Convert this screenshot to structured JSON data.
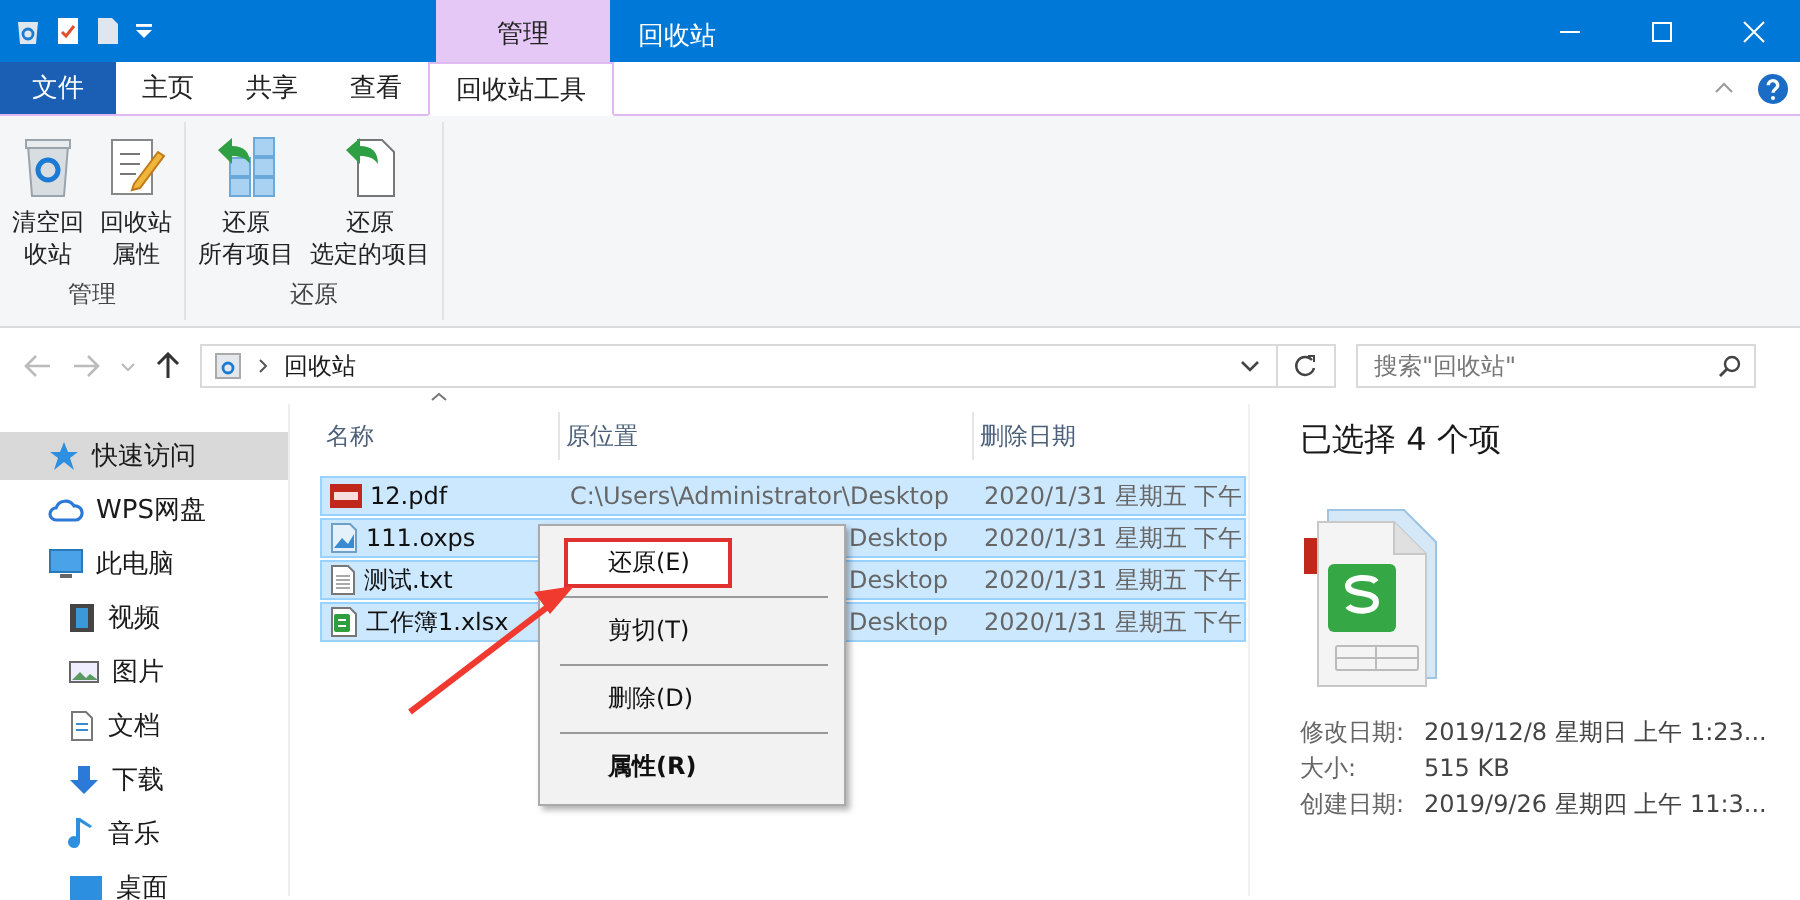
{
  "title_bar": {
    "context_tab": "管理",
    "title": "回收站"
  },
  "ribbon": {
    "tabs": [
      {
        "label": "文件",
        "kind": "file",
        "selected": false
      },
      {
        "label": "主页",
        "kind": "tab",
        "selected": false
      },
      {
        "label": "共享",
        "kind": "tab",
        "selected": false
      },
      {
        "label": "查看",
        "kind": "tab",
        "selected": false
      },
      {
        "label": "回收站工具",
        "kind": "context",
        "selected": true
      }
    ],
    "groups": [
      {
        "label": "管理",
        "buttons": [
          {
            "kind": "empty-bin",
            "lines": [
              "清空回",
              "收站"
            ]
          },
          {
            "kind": "properties",
            "lines": [
              "回收站",
              "属性"
            ]
          }
        ]
      },
      {
        "label": "还原",
        "buttons": [
          {
            "kind": "restore-all",
            "lines": [
              "还原",
              "所有项目"
            ]
          },
          {
            "kind": "restore-selected",
            "lines": [
              "还原",
              "选定的项目"
            ]
          }
        ]
      }
    ]
  },
  "address": {
    "path": "回收站"
  },
  "search": {
    "placeholder": "搜索\"回收站\""
  },
  "sidebar": {
    "items": [
      {
        "label": "快速访问",
        "kind": "star",
        "selected": true
      },
      {
        "label": "WPS网盘",
        "kind": "cloud",
        "selected": false
      },
      {
        "label": "此电脑",
        "kind": "pc",
        "selected": false,
        "children": [
          {
            "label": "视频",
            "kind": "video",
            "selected": false
          },
          {
            "label": "图片",
            "kind": "pictures",
            "selected": false
          },
          {
            "label": "文档",
            "kind": "document",
            "selected": false
          },
          {
            "label": "下载",
            "kind": "download",
            "selected": false
          },
          {
            "label": "音乐",
            "kind": "music",
            "selected": false
          },
          {
            "label": "桌面",
            "kind": "desktop",
            "selected": false
          }
        ]
      }
    ]
  },
  "file_list": {
    "columns": [
      "名称",
      "原位置",
      "删除日期"
    ],
    "rows": [
      {
        "name": "12.pdf",
        "kind": "pdf",
        "location": "C:\\Users\\Administrator\\Desktop",
        "deleted": "2020/1/31 星期五 下午",
        "selected": true
      },
      {
        "name": "111.oxps",
        "kind": "oxps",
        "location": "Desktop",
        "deleted": "2020/1/31 星期五 下午",
        "selected": true
      },
      {
        "name": "测试.txt",
        "kind": "txt",
        "location": "Desktop",
        "deleted": "2020/1/31 星期五 下午",
        "selected": true
      },
      {
        "name": "工作簿1.xlsx",
        "kind": "xlsx",
        "location": "Desktop",
        "deleted": "2020/1/31 星期五 下午",
        "selected": true
      }
    ]
  },
  "context_menu": {
    "items": [
      {
        "label": "还原(E)",
        "highlighted": true,
        "default": false
      },
      {
        "label": "剪切(T)",
        "highlighted": false,
        "default": false
      },
      {
        "label": "删除(D)",
        "highlighted": false,
        "default": false
      },
      {
        "label": "属性(R)",
        "highlighted": false,
        "default": true
      }
    ]
  },
  "details": {
    "heading": "已选择 4 个项",
    "properties": [
      {
        "label": "修改日期:",
        "value": "2019/12/8 星期日 上午 1:23..."
      },
      {
        "label": "大小:",
        "value": "515 KB"
      },
      {
        "label": "创建日期:",
        "value": "2019/9/26 星期四 上午 11:3..."
      }
    ]
  }
}
